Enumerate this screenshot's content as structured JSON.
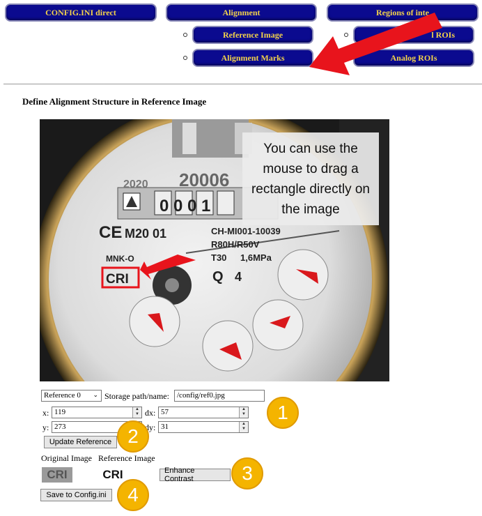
{
  "nav": {
    "config_ini_direct": "CONFIG.INI direct",
    "alignment": "Alignment",
    "regions_of_interest": "Regions of inte",
    "reference_image": "Reference Image",
    "alignment_marks": "Alignment Marks",
    "digital_rois": "l ROIs",
    "analog_rois": "Analog ROIs"
  },
  "page": {
    "heading": "Define Alignment Structure in Reference Image"
  },
  "photo": {
    "tooltip": "You can use the mouse to drag a rectangle directly on the image",
    "meter_text": {
      "year": "2020",
      "serial_top": "20006",
      "counter": "0 0 0 1",
      "ce": "CE",
      "m20": "M20 01",
      "model": "CH-MI001-10039",
      "r80": "R80H/R50V",
      "t30": "T30",
      "mpa": "1,6MPa",
      "mnk": "MNK-O",
      "cri": "CRI",
      "q": "Q",
      "q_value": "4"
    }
  },
  "form": {
    "reference_select": "Reference 0",
    "storage_label": "Storage path/name:",
    "storage_value": "/config/ref0.jpg",
    "x_label": "x:",
    "x_value": "119",
    "dx_label": "dx:",
    "dx_value": "57",
    "y_label": "y:",
    "y_value": "273",
    "dy_label": "dy:",
    "dy_value": "31",
    "update_reference": "Update Reference",
    "original_image_label": "Original Image",
    "reference_image_label": "Reference Image",
    "enhance_contrast": "Enhance Contrast",
    "save_config": "Save to Config.ini",
    "thumb_text": "CRI"
  },
  "badges": [
    "1",
    "2",
    "3",
    "4"
  ],
  "colors": {
    "nav_bg": "#0b0a8f",
    "nav_text": "#f2d24a",
    "arrow": "#e8141c",
    "badge": "#f4b400"
  }
}
